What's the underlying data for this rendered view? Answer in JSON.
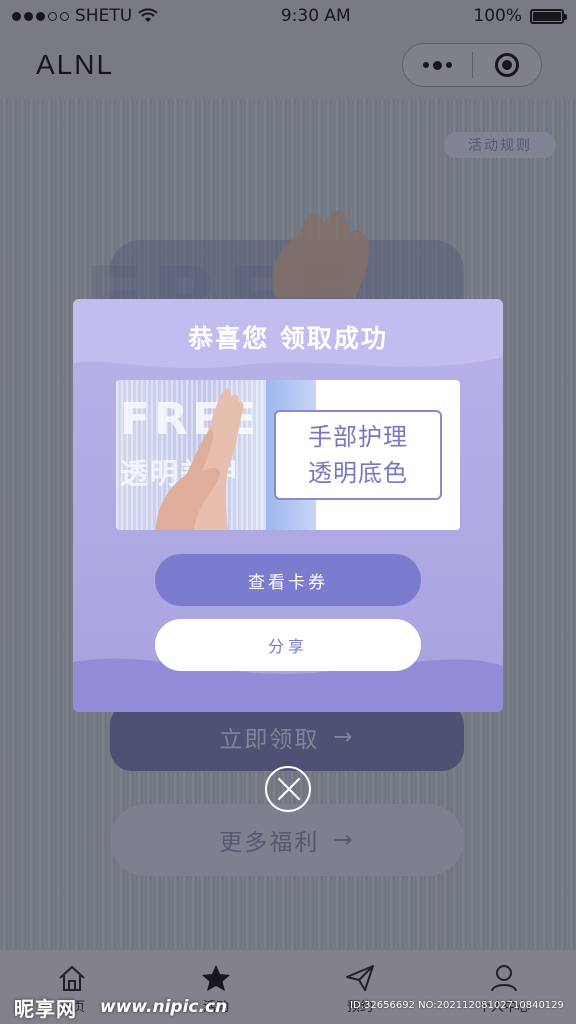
{
  "status_bar": {
    "carrier": "SHETU",
    "time": "9:30 AM",
    "battery": "100%"
  },
  "nav": {
    "title": "ALNL"
  },
  "background": {
    "rules_label": "活动规则",
    "banner_text": "FREE",
    "claim_label": "立即领取",
    "more_label": "更多福利",
    "arrow": "→"
  },
  "tabs": [
    {
      "label": "首页",
      "icon": "home-icon"
    },
    {
      "label": "活动",
      "icon": "star-icon"
    },
    {
      "label": "预约",
      "icon": "send-icon"
    },
    {
      "label": "个人中心",
      "icon": "user-icon"
    }
  ],
  "modal": {
    "title": "恭喜您 领取成功",
    "coupon": {
      "img_text": "FREE",
      "img_subtext": "透明美甲",
      "line1": "手部护理",
      "line2": "透明底色"
    },
    "view_label": "查看卡券",
    "share_label": "分享"
  },
  "watermark": {
    "logo": "昵享网",
    "url": "www.nipic.cn",
    "id": "ID:32656692 NO:20211208102710840129"
  },
  "colors": {
    "accent": "#7b7bd0",
    "modal_bg": "#b0abe4",
    "share_text": "#7a7ac4"
  }
}
